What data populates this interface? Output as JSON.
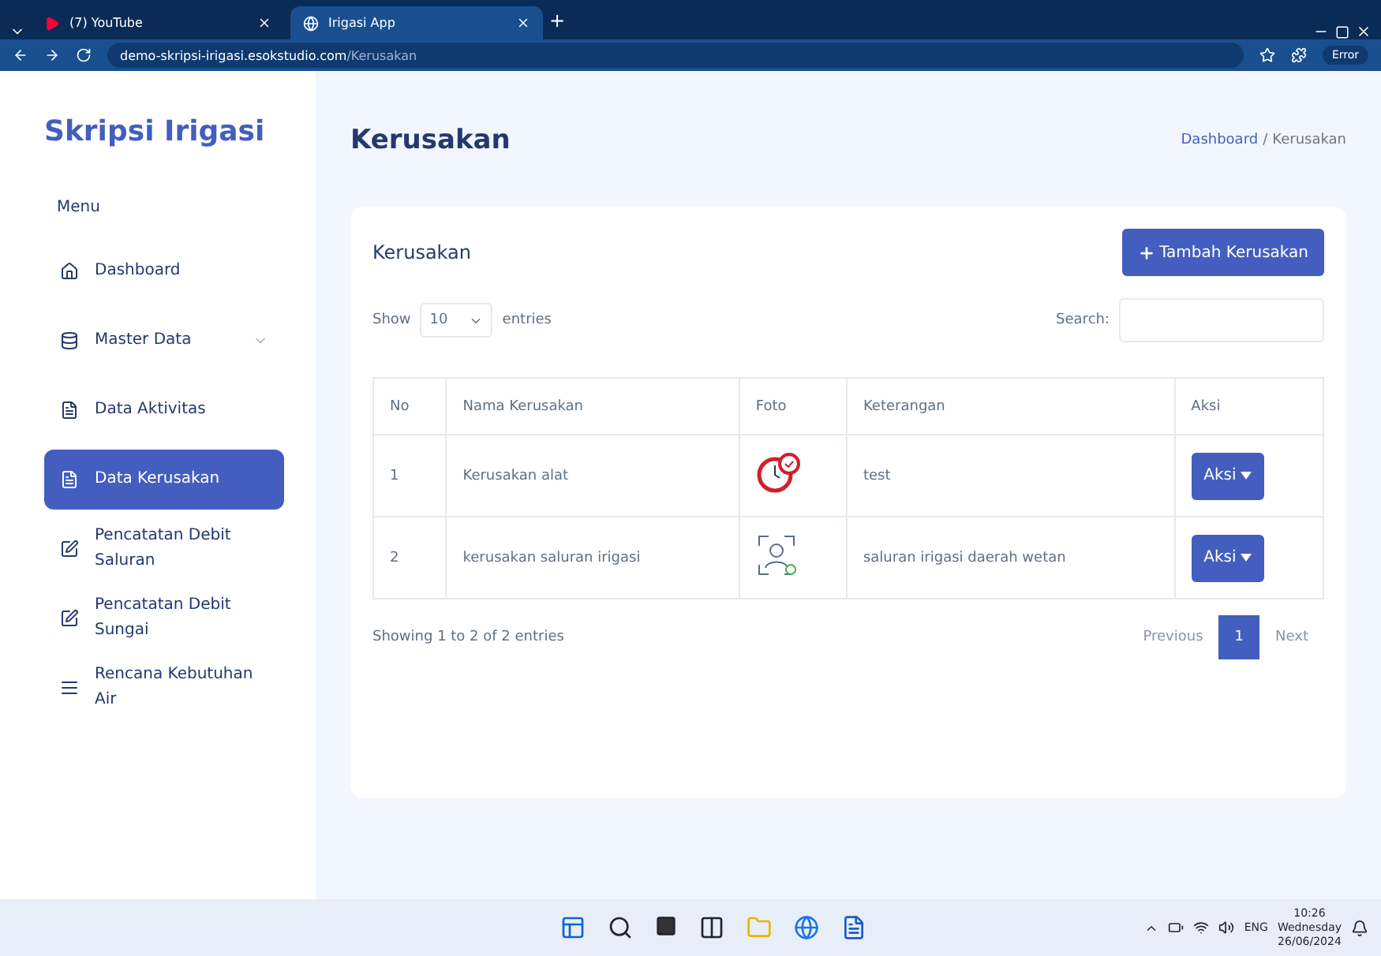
{
  "browser": {
    "tabs": [
      {
        "title": "(7) YouTube",
        "kind": "youtube",
        "selected": false
      },
      {
        "title": "Irigasi App",
        "kind": "globe",
        "selected": true
      }
    ],
    "new_tab": "+",
    "address": {
      "host": "demo-skripsi-irigasi.esokstudio.com",
      "path": "/Kerusakan"
    },
    "profile_label": "Error"
  },
  "sidebar": {
    "brand": "Skripsi Irigasi",
    "menu_label": "Menu",
    "items": [
      {
        "label": "Dashboard",
        "selected": false
      },
      {
        "label": "Master Data",
        "selected": false,
        "expanded": false
      },
      {
        "label": "Data Aktivitas",
        "selected": false
      },
      {
        "label": "Data Kerusakan",
        "selected": true
      },
      {
        "label": "Pencatatan Debit Saluran",
        "selected": false
      },
      {
        "label": "Pencatatan Debit Sungai",
        "selected": false
      },
      {
        "label": "Rencana Kebutuhan Air",
        "selected": false
      }
    ]
  },
  "page": {
    "title": "Kerusakan",
    "breadcrumb": [
      "Dashboard",
      "Kerusakan"
    ],
    "breadcrumb_separator": "/"
  },
  "card": {
    "title": "Kerusakan",
    "add_button": "Tambah Kerusakan",
    "show_label": "Show",
    "entries_value": "10",
    "entries_label": "entries",
    "search_label": "Search:",
    "table": {
      "columns": [
        "No",
        "Nama Kerusakan",
        "Foto",
        "Keterangan",
        "Aksi"
      ],
      "rows": [
        {
          "no": "1",
          "name": "Kerusakan alat",
          "note": "test",
          "action": "Aksi"
        },
        {
          "no": "2",
          "name": "kerusakan saluran irigasi",
          "note": "saluran irigasi daerah wetan",
          "action": "Aksi"
        }
      ]
    },
    "info": "Showing 1 to 2 of 2 entries",
    "pagination": [
      {
        "label": "Previous",
        "selected": false
      },
      {
        "label": "1",
        "selected": true
      },
      {
        "label": "Next",
        "selected": false
      }
    ]
  },
  "taskbar": {
    "tray_language": "ENG",
    "time": "10:26",
    "day": "Wednesday",
    "date": "26/06/2024"
  }
}
